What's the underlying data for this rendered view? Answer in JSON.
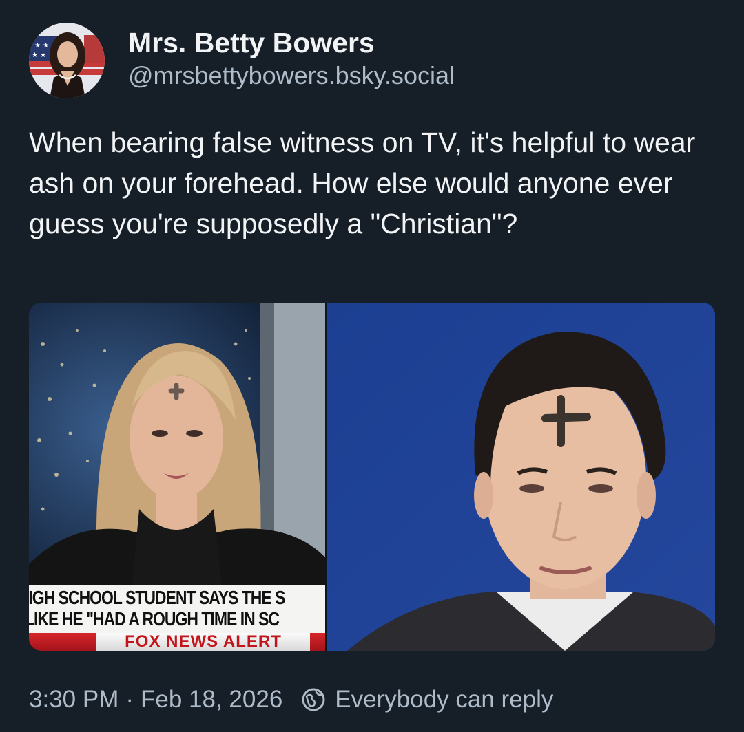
{
  "author": {
    "display_name": "Mrs. Betty Bowers",
    "handle": "@mrsbettybowers.bsky.social",
    "avatar_icon": "avatar-portrait"
  },
  "post": {
    "text": "When bearing false witness on TV, it's helpful to wear ash on your forehead. How else would anyone ever guess you're supposedly a \"Christian\"?"
  },
  "media": {
    "left_image": {
      "chyron_line_1": "IIGH SCHOOL STUDENT SAYS THE S",
      "chyron_line_2": "LIKE HE \"HAD A ROUGH TIME IN SC",
      "chyron_alert": "FOX NEWS ALERT"
    },
    "right_image": {}
  },
  "footer": {
    "time": "3:30 PM",
    "separator": "·",
    "date": "Feb 18, 2026",
    "reply_icon": "reply-permission-icon",
    "reply_setting": "Everybody can reply"
  },
  "colors": {
    "background": "#161e27",
    "text_primary": "#f1f3f5",
    "text_secondary": "#aebbc9",
    "fox_alert_red": "#c2141a"
  }
}
